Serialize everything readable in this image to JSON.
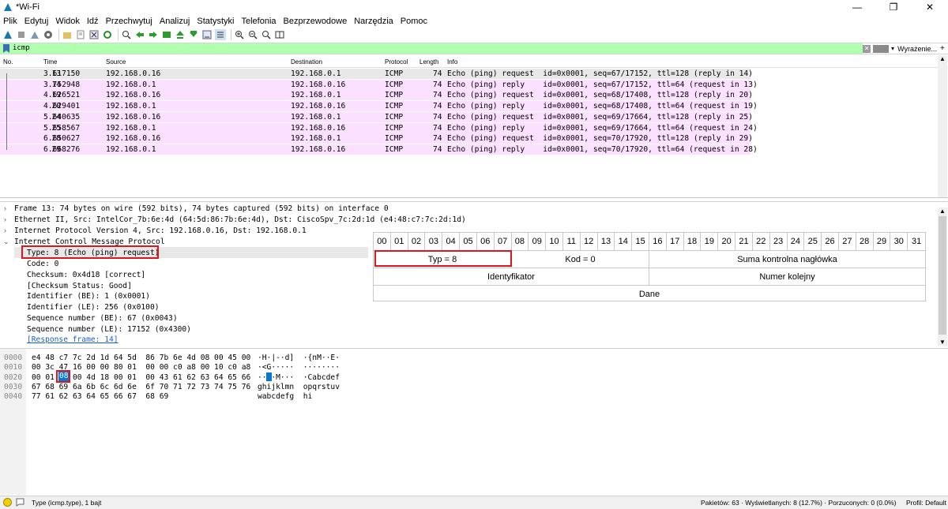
{
  "window": {
    "title": "*Wi-Fi"
  },
  "menu": [
    "Plik",
    "Edytuj",
    "Widok",
    "Idź",
    "Przechwytuj",
    "Analizuj",
    "Statystyki",
    "Telefonia",
    "Bezprzewodowe",
    "Narzędzia",
    "Pomoc"
  ],
  "filter": {
    "value": "icmp",
    "expressions_label": "Wyrażenie..."
  },
  "columns": [
    "No.",
    "Time",
    "Source",
    "Destination",
    "Protocol",
    "Length",
    "Info"
  ],
  "packets": [
    {
      "no": "13",
      "time": "3.617150",
      "src": "192.168.0.16",
      "dst": "192.168.0.1",
      "proto": "ICMP",
      "len": "74",
      "info": "Echo (ping) request  id=0x0001, seq=67/17152, ttl=128 (reply in 14)"
    },
    {
      "no": "14",
      "time": "3.752948",
      "src": "192.168.0.1",
      "dst": "192.168.0.16",
      "proto": "ICMP",
      "len": "74",
      "info": "Echo (ping) reply    id=0x0001, seq=67/17152, ttl=64 (request in 13)"
    },
    {
      "no": "19",
      "time": "4.626521",
      "src": "192.168.0.16",
      "dst": "192.168.0.1",
      "proto": "ICMP",
      "len": "74",
      "info": "Echo (ping) request  id=0x0001, seq=68/17408, ttl=128 (reply in 20)"
    },
    {
      "no": "20",
      "time": "4.629401",
      "src": "192.168.0.1",
      "dst": "192.168.0.16",
      "proto": "ICMP",
      "len": "74",
      "info": "Echo (ping) reply    id=0x0001, seq=68/17408, ttl=64 (request in 19)"
    },
    {
      "no": "24",
      "time": "5.640635",
      "src": "192.168.0.16",
      "dst": "192.168.0.1",
      "proto": "ICMP",
      "len": "74",
      "info": "Echo (ping) request  id=0x0001, seq=69/17664, ttl=128 (reply in 25)"
    },
    {
      "no": "25",
      "time": "5.658567",
      "src": "192.168.0.1",
      "dst": "192.168.0.16",
      "proto": "ICMP",
      "len": "74",
      "info": "Echo (ping) reply    id=0x0001, seq=69/17664, ttl=64 (request in 24)"
    },
    {
      "no": "28",
      "time": "6.650627",
      "src": "192.168.0.16",
      "dst": "192.168.0.1",
      "proto": "ICMP",
      "len": "74",
      "info": "Echo (ping) request  id=0x0001, seq=70/17920, ttl=128 (reply in 29)"
    },
    {
      "no": "29",
      "time": "6.668276",
      "src": "192.168.0.1",
      "dst": "192.168.0.16",
      "proto": "ICMP",
      "len": "74",
      "info": "Echo (ping) reply    id=0x0001, seq=70/17920, ttl=64 (request in 28)"
    }
  ],
  "details": {
    "frame": "Frame 13: 74 bytes on wire (592 bits), 74 bytes captured (592 bits) on interface 0",
    "ethernet": "Ethernet II, Src: IntelCor_7b:6e:4d (64:5d:86:7b:6e:4d), Dst: CiscoSpv_7c:2d:1d (e4:48:c7:7c:2d:1d)",
    "ip": "Internet Protocol Version 4, Src: 192.168.0.16, Dst: 192.168.0.1",
    "icmp": "Internet Control Message Protocol",
    "icmp_fields": [
      "Type: 8 (Echo (ping) request)",
      "Code: 0",
      "Checksum: 0x4d18 [correct]",
      "[Checksum Status: Good]",
      "Identifier (BE): 1 (0x0001)",
      "Identifier (LE): 256 (0x0100)",
      "Sequence number (BE): 67 (0x0043)",
      "Sequence number (LE): 17152 (0x4300)",
      "[Response frame: 14]"
    ]
  },
  "diagram": {
    "bits": [
      "00",
      "01",
      "02",
      "03",
      "04",
      "05",
      "06",
      "07",
      "08",
      "09",
      "10",
      "11",
      "12",
      "13",
      "14",
      "15",
      "16",
      "17",
      "18",
      "19",
      "20",
      "21",
      "22",
      "23",
      "24",
      "25",
      "26",
      "27",
      "28",
      "29",
      "30",
      "31"
    ],
    "type": "Typ = 8",
    "code": "Kod = 0",
    "checksum": "Suma kontrolna nagłówka",
    "identifier": "Identyfikator",
    "seq": "Numer kolejny",
    "data": "Dane"
  },
  "hex": [
    {
      "off": "0000",
      "bytes": "e4 48 c7 7c 2d 1d 64 5d  86 7b 6e 4d 08 00 45 00",
      "ascii": "·H·|-·d]  ·{nM··E·"
    },
    {
      "off": "0010",
      "bytes": "00 3c 47 16 00 00 80 01  00 00 c0 a8 00 10 c0 a8",
      "ascii": "·<G·····  ········"
    },
    {
      "off": "0020",
      "bytes": "00 01 08 00 4d 18 00 01  00 43 61 62 63 64 65 66",
      "ascii": "····M···  ·Cabcdef"
    },
    {
      "off": "0030",
      "bytes": "67 68 69 6a 6b 6c 6d 6e  6f 70 71 72 73 74 75 76",
      "ascii": "ghijklmn  opqrstuv"
    },
    {
      "off": "0040",
      "bytes": "77 61 62 63 64 65 66 67  68 69",
      "ascii": "wabcdefg  hi"
    }
  ],
  "status": {
    "field": "Type (icmp.type), 1 bajt",
    "packets": "Pakietów: 63 · Wyświetlanych: 8 (12.7%) · Porzuconych: 0 (0.0%)",
    "profile": "Profil: Default"
  },
  "colors": {
    "accent": "#e0141e",
    "filter_bg": "#afffaf",
    "row_pink": "#fce0ff",
    "row_selected": "#e8e8e8",
    "hex_highlight": "#0078d7"
  }
}
